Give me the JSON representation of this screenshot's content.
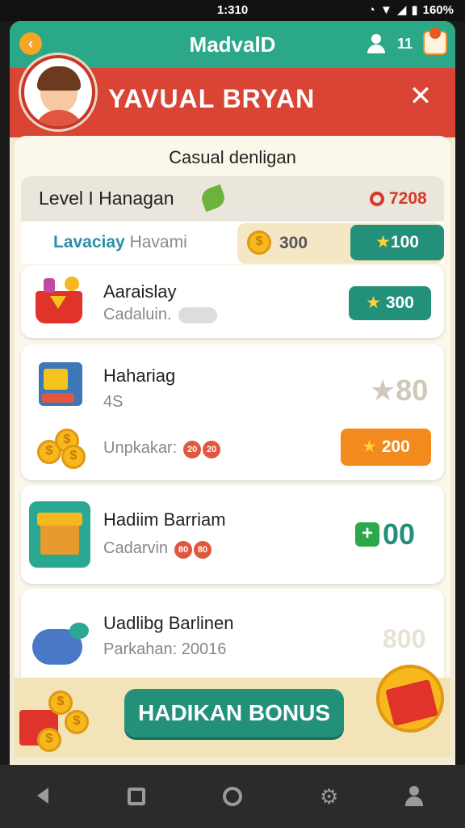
{
  "status_bar": {
    "time": "1:310",
    "battery": "160%"
  },
  "topbar": {
    "title": "MadvalD",
    "user_count": "11"
  },
  "profile": {
    "name": "YAVUAL BRYAN"
  },
  "card": {
    "subtitle": "Casual denligan",
    "level": {
      "label": "Level I Hanagan",
      "points": "7208"
    },
    "balance": {
      "label_main": "Lavaciay",
      "label_rest": " Havami",
      "coins": "300",
      "stars": "100"
    }
  },
  "tasks": [
    {
      "title": "Aaraislay",
      "subtitle": "Cadaluin.",
      "reward": "300"
    },
    {
      "title": "Hahariag",
      "subtitle": "4S",
      "reward_faded": "80",
      "sub_label": "Unpkakar:",
      "dots": [
        "20",
        "20"
      ],
      "reward": "200"
    },
    {
      "title": "Hadiim Barriam",
      "subtitle": "Cadarvin",
      "dots": [
        "80",
        "80"
      ],
      "reward": "00"
    },
    {
      "title": "Uadlibg Barlinen",
      "subtitle": "Parkahan: 20016",
      "reward_faded": "800"
    }
  ],
  "bonus_button": "HADIKAN BONUS",
  "colors": {
    "teal": "#23917a",
    "red": "#d94434",
    "orange": "#f28a1d",
    "green_header": "#2ba887"
  }
}
